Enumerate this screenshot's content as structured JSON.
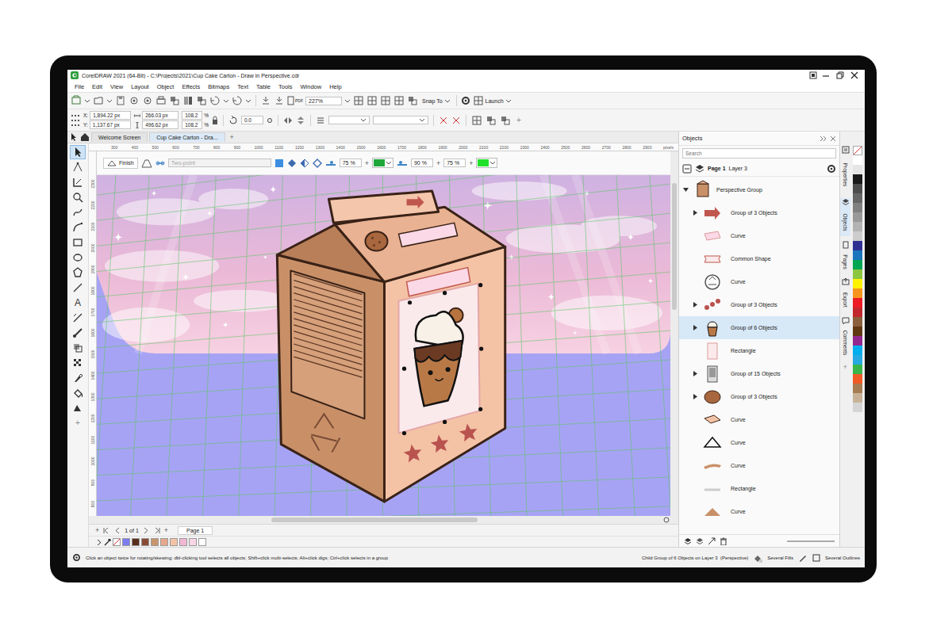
{
  "window": {
    "title": "CorelDRAW 2021 (64-Bit) - C:\\Projects\\2021\\Cup Cake Carton - Draw in Perspective.cdr"
  },
  "menu": [
    "File",
    "Edit",
    "View",
    "Layout",
    "Object",
    "Effects",
    "Bitmaps",
    "Text",
    "Table",
    "Tools",
    "Window",
    "Help"
  ],
  "toolbar": {
    "pdf": "PDF",
    "zoom": "227%",
    "snap": "Snap To",
    "launch": "Launch"
  },
  "property_bar": {
    "x_label": "X:",
    "x": "1,894.22 px",
    "y_label": "Y:",
    "y": "1,137.67 px",
    "width": "266.03 px",
    "height": "496.62 px",
    "scale_x": "108.2",
    "scale_x_unit": "%",
    "scale_y": "108.2",
    "scale_y_unit": "%",
    "angle": "0.0",
    "add": "+"
  },
  "doc_tabs": [
    {
      "label": "Welcome Screen",
      "selected": false
    },
    {
      "label": "Cup Cake Carton - Dra...",
      "selected": true
    }
  ],
  "new_tab": "+",
  "ruler": {
    "top": [
      "300",
      "400",
      "500",
      "600",
      "700",
      "800",
      "900",
      "1000",
      "1100",
      "1200",
      "1300",
      "1400",
      "1500",
      "1600",
      "1700",
      "1800",
      "1900",
      "2000",
      "2100",
      "2200",
      "2300",
      "2400",
      "2500",
      "2600",
      "2700",
      "2800",
      "2900"
    ],
    "unit": "pixels",
    "left": [
      "2300",
      "2200",
      "2100",
      "2000",
      "1900",
      "1800",
      "1700",
      "1600",
      "1500",
      "1400",
      "1300",
      "1200",
      "1100",
      "1000",
      "900",
      "800"
    ]
  },
  "toolbox": [
    {
      "selected": true
    },
    {
      "selected": false
    },
    {
      "selected": false
    },
    {
      "selected": false
    },
    {
      "selected": false
    },
    {
      "selected": false
    },
    {
      "selected": false
    },
    {
      "selected": false
    },
    {
      "selected": false
    },
    {
      "selected": false
    },
    {
      "selected": false,
      "glyph": "A"
    },
    {
      "selected": false
    },
    {
      "selected": false
    },
    {
      "selected": false
    },
    {
      "selected": false
    },
    {
      "selected": false
    },
    {
      "selected": false
    },
    {
      "selected": false
    }
  ],
  "toolbox_add": "+",
  "perspective_bar": {
    "finish": "Finish",
    "mode": "Two-point",
    "mode_disabled": true,
    "opacity_1": "75 %",
    "opacity_2": "90 %",
    "opacity_3": "75 %",
    "plus": "+",
    "colors": [
      {
        "color": "#1fa83a"
      },
      {
        "color": "#22e12a"
      }
    ]
  },
  "objects": {
    "title": "Objects",
    "search_placeholder": "Search",
    "page": "Page 1",
    "layer": "Layer 3",
    "tree": {
      "label": "Perspective Group",
      "expanded": true,
      "selected": false,
      "children": [
        {
          "label": "Group of 3 Objects",
          "expandable": true,
          "expanded": false,
          "selected": false
        },
        {
          "label": "Curve",
          "expandable": false,
          "selected": false
        },
        {
          "label": "Common Shape",
          "expandable": false,
          "selected": false
        },
        {
          "label": "Curve",
          "expandable": false,
          "selected": false
        },
        {
          "label": "Group of 3 Objects",
          "expandable": true,
          "expanded": false,
          "selected": false
        },
        {
          "label": "Group of 6 Objects",
          "expandable": true,
          "expanded": false,
          "selected": true
        },
        {
          "label": "Rectangle",
          "expandable": false,
          "selected": false
        },
        {
          "label": "Group of 15 Objects",
          "expandable": true,
          "expanded": false,
          "selected": false
        },
        {
          "label": "Group of 3 Objects",
          "expandable": true,
          "expanded": false,
          "selected": false
        },
        {
          "label": "Curve",
          "expandable": false,
          "selected": false
        },
        {
          "label": "Curve",
          "expandable": false,
          "selected": false
        },
        {
          "label": "Curve",
          "expandable": false,
          "selected": false
        },
        {
          "label": "Rectangle",
          "expandable": false,
          "selected": false
        },
        {
          "label": "Curve",
          "expandable": false,
          "selected": false
        }
      ]
    }
  },
  "docker_tabs": [
    {
      "label": "Properties",
      "selected": false
    },
    {
      "label": "Objects",
      "selected": true
    },
    {
      "label": "Pages",
      "selected": false
    },
    {
      "label": "Export",
      "selected": false
    },
    {
      "label": "Comments",
      "selected": false
    }
  ],
  "docker_add": "+",
  "palette": [
    "#ffffff",
    "#e6e6e6",
    "#1a1a1a",
    "#4d4d4d",
    "#666666",
    "#808080",
    "#999999",
    "#b3b3b3",
    "#cccccc",
    "#2e3192",
    "#1b75bc",
    "#00a651",
    "#8dc63f",
    "#fff200",
    "#f7941d",
    "#ed1c24",
    "#c1272d",
    "#8b5e3c",
    "#603913",
    "#92278f",
    "#00aeef",
    "#27aae1",
    "#39b54a",
    "#f15a24",
    "#a67c52",
    "#c7b299",
    "#d4d4d4"
  ],
  "page_nav": {
    "add_before": "+",
    "position": "1 of 1",
    "add_after": "+",
    "page_tab": "Page 1"
  },
  "doc_palette": [
    "#7d7cf0",
    "#5a2d1c",
    "#8a4b36",
    "#c9956b",
    "#e6a88c",
    "#f3c3a6",
    "#f2b7d4",
    "#f8d7e6",
    "#ffffff"
  ],
  "status_bar": {
    "hint": "Click an object twice for rotating/skewing; dbl-clicking tool selects all objects; Shift+click multi-selects; Alt+click digs; Ctrl+click selects in a group",
    "selection": "Child Group of 6 Objects on Layer 3  (Perspective)",
    "fill": "Several Fills",
    "outline": "Several Outlines"
  }
}
